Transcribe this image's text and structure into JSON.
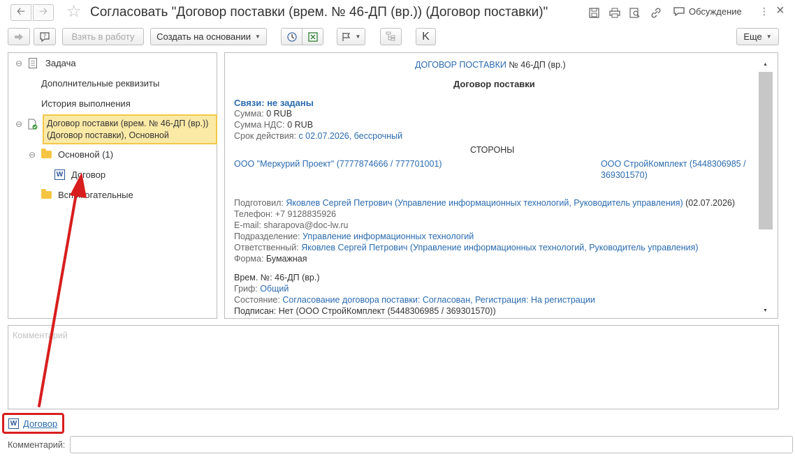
{
  "window": {
    "title": "Согласовать \"Договор поставки (врем. № 46-ДП (вр.)) (Договор поставки)\"",
    "discussion_label": "Обсуждение",
    "more_symbol": "⋮",
    "close_symbol": "×"
  },
  "toolbar": {
    "take_to_work": "Взять в работу",
    "create_based_on": "Создать на основании",
    "k_label": "K",
    "more": "Еще"
  },
  "tree": {
    "task": "Задача",
    "additional_attributes": "Дополнительные реквизиты",
    "execution_history": "История выполнения",
    "selected_doc": "Договор поставки (врем. № 46-ДП (вр.)) (Договор поставки), Основной",
    "main_folder": "Основной (1)",
    "contract_file": "Договор",
    "auxiliary_folder": "Вспомогательные"
  },
  "document": {
    "header_link": "ДОГОВОР ПОСТАВКИ",
    "header_number": "№ 46-ДП (вр.)",
    "title": "Договор поставки",
    "links": "Связи: не заданы",
    "sum_label": "Сумма:",
    "sum_value": "0 RUB",
    "vat_label": "Сумма НДС:",
    "vat_value": "0 RUB",
    "validity_label": "Срок действия:",
    "validity_value": "с 02.07.2026, бессрочный",
    "parties": "СТОРОНЫ",
    "party1": "ООО \"Меркурий Проект\" (7777874666 / 777701001)",
    "party2_line1": "ООО СтройКомплект (5448306985 /",
    "party2_line2": "369301570)",
    "prepared_label": "Подготовил:",
    "prepared_value": "Яковлев Сергей Петрович (Управление информационных технологий, Руководитель управления)",
    "prepared_date": "(02.07.2026)",
    "phone": "Телефон: +7 9128835926",
    "email": "E-mail: sharapova@doc-lw.ru",
    "department_label": "Подразделение:",
    "department_value": "Управление информационных технологий",
    "responsible_label": "Ответственный:",
    "responsible_value": "Яковлев Сергей Петрович (Управление информационных технологий, Руководитель управления)",
    "form_label": "Форма:",
    "form_value": "Бумажная",
    "temp_number": "Врем. №: 46-ДП (вр.)",
    "stamp_label": "Гриф:",
    "stamp_value": "Общий",
    "state_label": "Состояние:",
    "state_value": "Согласование договора поставки: Согласован, Регистрация: На регистрации",
    "signed": "Подписан: Нет (ООО СтройКомплект (5448306985 / 369301570))"
  },
  "comment_placeholder": "Комментарий",
  "attachment_link": "Договор",
  "comment_label": "Комментарий:",
  "word_icon_letter": "W",
  "colors": {
    "link": "#2a6bb0",
    "selection_bg": "#fbe9a6",
    "selection_border": "#f2c84a",
    "highlight_red": "#d81e1e"
  }
}
